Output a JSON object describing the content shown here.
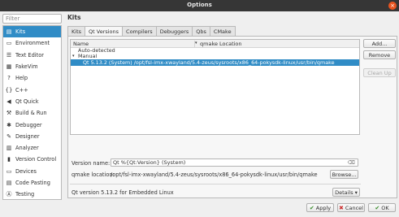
{
  "window": {
    "title": "Options",
    "close_glyph": "×"
  },
  "filter": {
    "placeholder": "Filter"
  },
  "sidebar": {
    "items": [
      {
        "label": "Kits",
        "icon": "kits-icon",
        "glyph": "▤",
        "active": true
      },
      {
        "label": "Environment",
        "icon": "monitor-icon",
        "glyph": "▭",
        "active": false
      },
      {
        "label": "Text Editor",
        "icon": "text-editor-icon",
        "glyph": "☰",
        "active": false
      },
      {
        "label": "FakeVim",
        "icon": "fakevim-icon",
        "glyph": "▦",
        "active": false
      },
      {
        "label": "Help",
        "icon": "help-icon",
        "glyph": "?",
        "active": false
      },
      {
        "label": "C++",
        "icon": "cpp-icon",
        "glyph": "{}",
        "active": false
      },
      {
        "label": "Qt Quick",
        "icon": "qt-quick-icon",
        "glyph": "◀",
        "active": false
      },
      {
        "label": "Build & Run",
        "icon": "build-run-icon",
        "glyph": "⚒",
        "active": false
      },
      {
        "label": "Debugger",
        "icon": "debugger-icon",
        "glyph": "✱",
        "active": false
      },
      {
        "label": "Designer",
        "icon": "designer-icon",
        "glyph": "✎",
        "active": false
      },
      {
        "label": "Analyzer",
        "icon": "analyzer-icon",
        "glyph": "▥",
        "active": false
      },
      {
        "label": "Version Control",
        "icon": "version-control-icon",
        "glyph": "▮",
        "active": false
      },
      {
        "label": "Devices",
        "icon": "devices-icon",
        "glyph": "▭",
        "active": false
      },
      {
        "label": "Code Pasting",
        "icon": "code-pasting-icon",
        "glyph": "▤",
        "active": false
      },
      {
        "label": "Testing",
        "icon": "testing-icon",
        "glyph": "Ⓐ",
        "active": false
      }
    ]
  },
  "main": {
    "title": "Kits",
    "tabs": [
      {
        "label": "Kits",
        "active": false
      },
      {
        "label": "Qt Versions",
        "active": true
      },
      {
        "label": "Compilers",
        "active": false
      },
      {
        "label": "Debuggers",
        "active": false
      },
      {
        "label": "Qbs",
        "active": false
      },
      {
        "label": "CMake",
        "active": false
      }
    ],
    "tree": {
      "columns": [
        "Name",
        "qmake Location"
      ],
      "sort_glyph": "▾",
      "groups": [
        {
          "label": "Auto-detected",
          "expanded": false,
          "caret": ""
        },
        {
          "label": "Manual",
          "expanded": true,
          "caret": "▾"
        }
      ],
      "selected_row": "Qt 5.13.2 (System)  /opt/fsl-imx-xwayland/5.4-zeus/sysroots/x86_64-pokysdk-linux/usr/bin/qmake"
    },
    "side_buttons": {
      "add": "Add...",
      "remove": "Remove",
      "clean_up": "Clean Up"
    },
    "version_name_label": "Version name:",
    "version_name_value": "Qt %{Qt:Version} (System)",
    "qmake_location_label": "qmake location:",
    "qmake_location_value": "/opt/fsl-imx-xwayland/5.4-zeus/sysroots/x86_64-pokysdk-linux/usr/bin/qmake",
    "browse_label": "Browse...",
    "version_info": "Qt version 5.13.2 for Embedded Linux",
    "details_label": "Details ▾"
  },
  "footer": {
    "apply": "Apply",
    "cancel": "Cancel",
    "ok": "OK"
  },
  "colors": {
    "selection": "#308cc6",
    "close_button": "#e95420",
    "titlebar": "#363636"
  }
}
